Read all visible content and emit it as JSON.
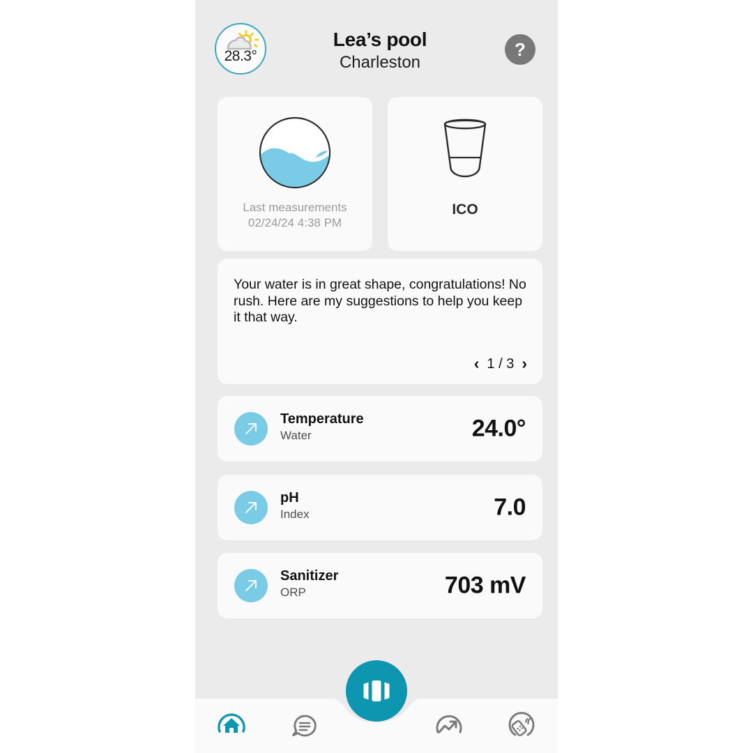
{
  "header": {
    "weather_temp": "28.3°",
    "weather_icon": "sun-behind-cloud-icon",
    "pool_title": "Lea’s pool",
    "pool_city": "Charleston",
    "help_label": "?",
    "accent_color": "#0e96b0",
    "badge_border_color": "#3ba6bf"
  },
  "cards": {
    "water": {
      "icon": "water-wave-circle-icon",
      "caption_line1": "Last measurements",
      "caption_line2": "02/24/24 4:38 PM"
    },
    "device": {
      "icon": "ico-device-icon",
      "label": "ICO"
    }
  },
  "advice": {
    "text": "Your water is in great shape, congratulations! No rush. Here are my suggestions to help you keep it that way.",
    "prev_label": "‹",
    "next_label": "›",
    "counter": "1 / 3"
  },
  "metrics": [
    {
      "name": "Temperature",
      "unit": "Water",
      "value": "24.0°",
      "icon": "arrow-up-right-icon",
      "icon_color": "#79cbe6"
    },
    {
      "name": "pH",
      "unit": "Index",
      "value": "7.0",
      "icon": "arrow-up-right-icon",
      "icon_color": "#79cbe6"
    },
    {
      "name": "Sanitizer",
      "unit": "ORP",
      "value": "703 mV",
      "icon": "arrow-up-right-icon",
      "icon_color": "#79cbe6"
    }
  ],
  "navigation": {
    "items": [
      {
        "icon": "home-icon",
        "active": true
      },
      {
        "icon": "chat-bubble-icon",
        "active": false
      },
      {
        "icon": "analytics-trend-icon",
        "active": false
      },
      {
        "icon": "remote-control-icon",
        "active": false
      }
    ],
    "fab_icon": "carousel-panels-icon",
    "active_color": "#0e96b0",
    "inactive_color": "#7a7a7a"
  }
}
